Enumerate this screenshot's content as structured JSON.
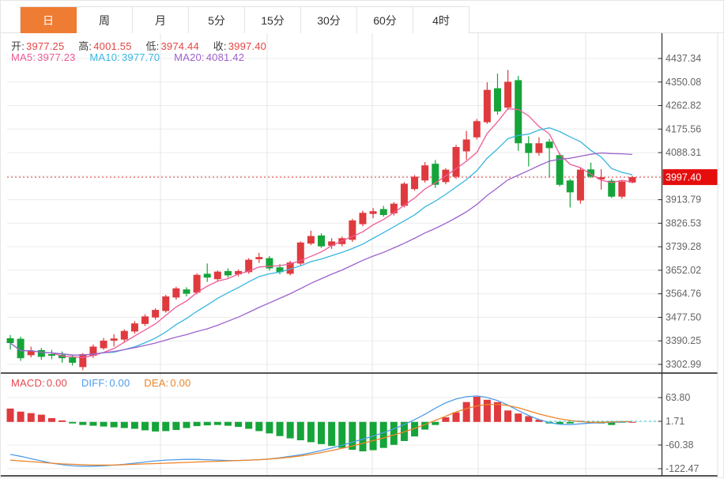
{
  "tabs": {
    "items": [
      {
        "label": "日",
        "active": true
      },
      {
        "label": "周",
        "active": false
      },
      {
        "label": "月",
        "active": false
      },
      {
        "label": "5分",
        "active": false
      },
      {
        "label": "15分",
        "active": false
      },
      {
        "label": "30分",
        "active": false
      },
      {
        "label": "60分",
        "active": false
      },
      {
        "label": "4时",
        "active": false
      }
    ]
  },
  "quote_bar": {
    "open_label": "开:",
    "open": "3977.25",
    "high_label": "高:",
    "high": "4001.55",
    "low_label": "低:",
    "low": "3974.44",
    "close_label": "收:",
    "close": "3997.40"
  },
  "ma_bar": {
    "ma5_label": "MA5:",
    "ma5": "3977.23",
    "ma10_label": "MA10:",
    "ma10": "3977.70",
    "ma20_label": "MA20:",
    "ma20": "4081.42"
  },
  "macd_bar": {
    "macd_label": "MACD:",
    "macd": "0.00",
    "diff_label": "DIFF:",
    "diff": "0.00",
    "dea_label": "DEA:",
    "dea": "0.00"
  },
  "colors": {
    "tab_active_bg": "#ef7c33",
    "tab_text": "#333333",
    "up": "#df3a3e",
    "down": "#15a439",
    "text_red": "#e64444",
    "ma5": "#ee5a98",
    "ma10": "#38b6e0",
    "ma20": "#9d62cc",
    "diff": "#4f9ce8",
    "dea": "#ee8327",
    "macd_label": "#e5474d",
    "badge_bg": "#e60d0d",
    "badge_text": "#ffffff",
    "grid": "#ececec",
    "grid_vertical": "#e6e6e6",
    "axis_text": "#646464",
    "axis_line": "#2b2b2b",
    "panel_border": "#1c1c1c",
    "current_price_line": "#e03b3b",
    "zero_dash": "#2ec4c9",
    "quote_label": "#404040"
  },
  "chart_data": [
    {
      "type": "candlestick",
      "period": "日",
      "current_price": 3997.4,
      "current_price_label": "3997.40",
      "ma_windows": [
        5,
        10,
        20
      ],
      "axis": {
        "top_value": 4437.34,
        "bottom_value": 3302.99,
        "tick_labels": [
          "4437.34",
          "4350.08",
          "4262.82",
          "4175.56",
          "4088.31",
          "3913.79",
          "3826.53",
          "3739.28",
          "3652.02",
          "3564.76",
          "3477.50",
          "3390.25",
          "3302.99"
        ],
        "gridline_values": [
          4437.34,
          4350.08,
          4262.82,
          4175.56,
          4088.31,
          4001.05,
          3913.79,
          3826.53,
          3739.28,
          3652.02,
          3564.76,
          3477.5,
          3390.25,
          3302.99
        ]
      },
      "candles": [
        [
          3400,
          3412,
          3358,
          3382
        ],
        [
          3398,
          3406,
          3316,
          3326
        ],
        [
          3337,
          3369,
          3329,
          3354
        ],
        [
          3356,
          3364,
          3320,
          3331
        ],
        [
          3341,
          3357,
          3322,
          3335
        ],
        [
          3339,
          3351,
          3309,
          3326
        ],
        [
          3329,
          3337,
          3299,
          3309
        ],
        [
          3293,
          3345,
          3281,
          3341
        ],
        [
          3335,
          3377,
          3327,
          3369
        ],
        [
          3363,
          3401,
          3357,
          3391
        ],
        [
          3391,
          3415,
          3369,
          3399
        ],
        [
          3395,
          3433,
          3387,
          3427
        ],
        [
          3425,
          3463,
          3417,
          3455
        ],
        [
          3453,
          3489,
          3445,
          3481
        ],
        [
          3477,
          3511,
          3469,
          3505
        ],
        [
          3501,
          3561,
          3495,
          3555
        ],
        [
          3551,
          3591,
          3543,
          3585
        ],
        [
          3581,
          3589,
          3555,
          3565
        ],
        [
          3569,
          3641,
          3563,
          3635
        ],
        [
          3639,
          3677,
          3609,
          3625
        ],
        [
          3619,
          3651,
          3611,
          3647
        ],
        [
          3649,
          3659,
          3625,
          3633
        ],
        [
          3637,
          3655,
          3629,
          3649
        ],
        [
          3645,
          3697,
          3639,
          3691
        ],
        [
          3693,
          3717,
          3679,
          3701
        ],
        [
          3697,
          3705,
          3651,
          3659
        ],
        [
          3663,
          3675,
          3637,
          3645
        ],
        [
          3639,
          3687,
          3633,
          3681
        ],
        [
          3677,
          3759,
          3671,
          3755
        ],
        [
          3751,
          3799,
          3745,
          3779
        ],
        [
          3781,
          3789,
          3735,
          3741
        ],
        [
          3743,
          3771,
          3731,
          3759
        ],
        [
          3749,
          3777,
          3741,
          3771
        ],
        [
          3765,
          3843,
          3757,
          3837
        ],
        [
          3823,
          3873,
          3815,
          3865
        ],
        [
          3861,
          3883,
          3845,
          3871
        ],
        [
          3879,
          3891,
          3851,
          3857
        ],
        [
          3863,
          3905,
          3855,
          3899
        ],
        [
          3891,
          3979,
          3885,
          3973
        ],
        [
          3953,
          4005,
          3947,
          3999
        ],
        [
          3985,
          4053,
          3977,
          4041
        ],
        [
          4047,
          4061,
          3957,
          3969
        ],
        [
          3979,
          4031,
          3971,
          4025
        ],
        [
          3999,
          4117,
          3991,
          4109
        ],
        [
          4093,
          4169,
          4061,
          4137
        ],
        [
          4145,
          4213,
          4137,
          4205
        ],
        [
          4201,
          4349,
          4195,
          4321
        ],
        [
          4327,
          4381,
          4229,
          4241
        ],
        [
          4255,
          4395,
          4247,
          4351
        ],
        [
          4357,
          4373,
          4095,
          4123
        ],
        [
          4123,
          4149,
          4037,
          4087
        ],
        [
          4087,
          4145,
          4077,
          4123
        ],
        [
          4129,
          4139,
          3999,
          4105
        ],
        [
          4079,
          4087,
          3963,
          3969
        ],
        [
          3985,
          3991,
          3885,
          3941
        ],
        [
          3911,
          4033,
          3899,
          4025
        ],
        [
          4026,
          4051,
          3994,
          3999
        ],
        [
          3989,
          4027,
          3951,
          3997
        ],
        [
          3984,
          3991,
          3920,
          3925
        ],
        [
          3925,
          3983,
          3917,
          3981
        ],
        [
          3977.25,
          4001.55,
          3974.44,
          3997.4
        ]
      ]
    },
    {
      "type": "macd",
      "axis": {
        "tick_labels": [
          "63.80",
          "1.71",
          "-60.38",
          "-122.47"
        ],
        "tick_values": [
          63.8,
          1.71,
          -60.38,
          -122.47
        ]
      },
      "histogram": [
        35,
        27,
        23,
        19,
        10,
        4,
        -4,
        -8,
        -10,
        -12,
        -14,
        -16,
        -18,
        -22,
        -25,
        -24,
        -21,
        -16,
        -11,
        -9,
        -8,
        -10,
        -13,
        -18,
        -24,
        -30,
        -37,
        -43,
        -48,
        -53,
        -58,
        -63,
        -68,
        -73,
        -77,
        -74,
        -68,
        -60,
        -50,
        -38,
        -20,
        -8,
        12,
        25,
        52,
        66,
        58,
        52,
        30,
        22,
        15,
        6,
        -4,
        -6,
        -4,
        3,
        -3,
        -4,
        -8,
        -2,
        0
      ],
      "diff": [
        -85,
        -90,
        -96,
        -102,
        -108,
        -112,
        -115,
        -116,
        -116,
        -115,
        -113,
        -111,
        -108,
        -105,
        -102,
        -100,
        -99,
        -98,
        -98,
        -99,
        -100,
        -101,
        -101,
        -100,
        -99,
        -97,
        -94,
        -90,
        -86,
        -81,
        -75,
        -68,
        -61,
        -53,
        -45,
        -37,
        -28,
        -18,
        -7,
        6,
        20,
        36,
        50,
        60,
        66,
        68,
        64,
        56,
        44,
        30,
        17,
        6,
        -2,
        -6,
        -7,
        -5,
        -3,
        -2,
        -1,
        0,
        1
      ],
      "dea": [
        -100,
        -102,
        -104,
        -106,
        -108,
        -110,
        -111,
        -112,
        -113,
        -113,
        -113,
        -112,
        -111,
        -110,
        -109,
        -108,
        -107,
        -106,
        -105,
        -104,
        -103,
        -102,
        -101,
        -100,
        -99,
        -97,
        -95,
        -92,
        -89,
        -85,
        -80,
        -75,
        -69,
        -63,
        -56,
        -49,
        -42,
        -34,
        -26,
        -17,
        -7,
        4,
        15,
        26,
        35,
        42,
        46,
        46,
        43,
        37,
        29,
        21,
        14,
        8,
        4,
        1,
        -1,
        -1,
        0,
        1,
        1
      ]
    }
  ]
}
